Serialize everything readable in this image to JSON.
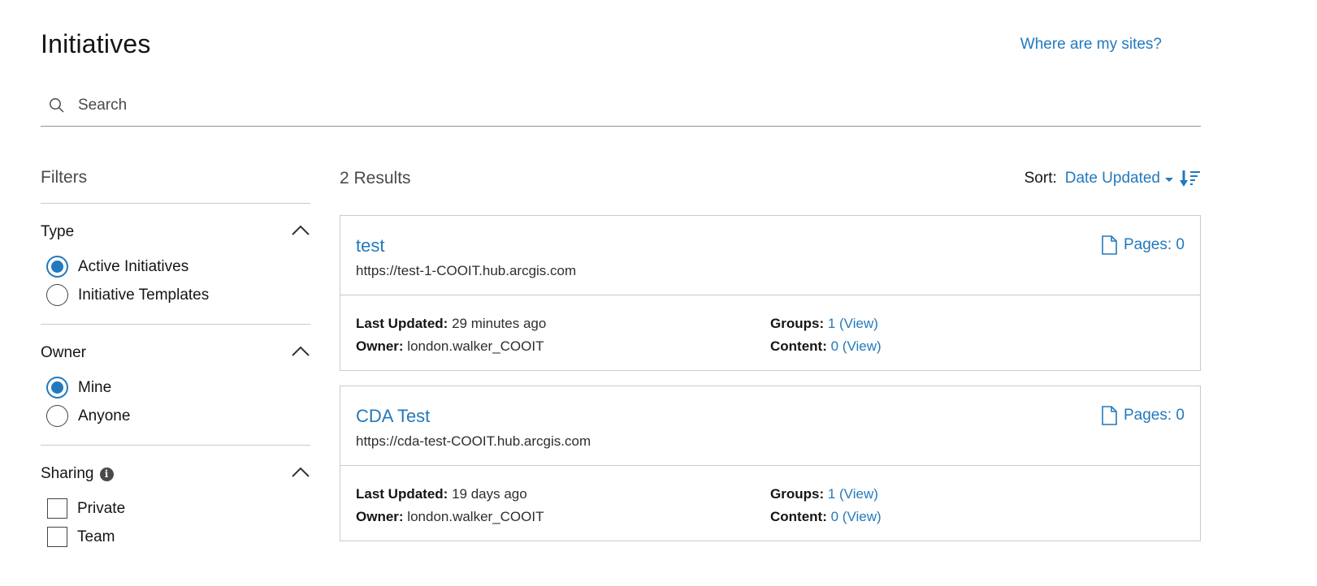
{
  "header": {
    "title": "Initiatives",
    "sites_link": "Where are my sites?"
  },
  "search": {
    "placeholder": "Search",
    "value": "",
    "icon": "search-icon"
  },
  "filters": {
    "title": "Filters",
    "type": {
      "label": "Type",
      "options": [
        {
          "label": "Active Initiatives",
          "selected": true
        },
        {
          "label": "Initiative Templates",
          "selected": false
        }
      ]
    },
    "owner": {
      "label": "Owner",
      "options": [
        {
          "label": "Mine",
          "selected": true
        },
        {
          "label": "Anyone",
          "selected": false
        }
      ]
    },
    "sharing": {
      "label": "Sharing",
      "info_icon": "i",
      "options": [
        {
          "label": "Private",
          "checked": false
        },
        {
          "label": "Team",
          "checked": false
        }
      ]
    }
  },
  "results": {
    "count_label": "2 Results",
    "sort_label": "Sort:",
    "sort_value": "Date Updated",
    "items": [
      {
        "title": "test",
        "url": "https://test-1-COOIT.hub.arcgis.com",
        "pages_label": "Pages: 0",
        "last_updated_label": "Last Updated:",
        "last_updated": "29 minutes ago",
        "owner_label": "Owner:",
        "owner": "london.walker_COOIT",
        "groups_label": "Groups:",
        "groups": "1 (View)",
        "content_label": "Content:",
        "content": "0 (View)"
      },
      {
        "title": "CDA Test",
        "url": "https://cda-test-COOIT.hub.arcgis.com",
        "pages_label": "Pages: 0",
        "last_updated_label": "Last Updated:",
        "last_updated": "19 days ago",
        "owner_label": "Owner:",
        "owner": "london.walker_COOIT",
        "groups_label": "Groups:",
        "groups": "1 (View)",
        "content_label": "Content:",
        "content": "0 (View)"
      }
    ]
  },
  "colors": {
    "accent": "#2279bd",
    "text": "#151515",
    "border": "#cacaca"
  }
}
